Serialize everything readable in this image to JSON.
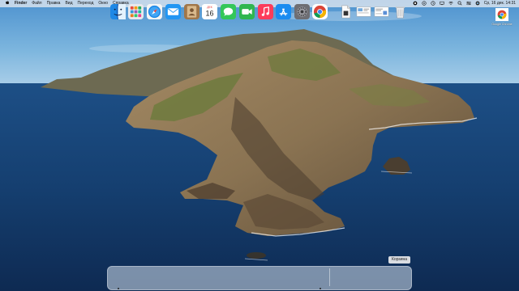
{
  "menubar": {
    "app_name": "Finder",
    "items": [
      "Файл",
      "Правка",
      "Вид",
      "Переход",
      "Окно",
      "Справка"
    ],
    "clock": "Ср, 16 дек.  14:31"
  },
  "desktop_icons": [
    {
      "label": "Google Chrome",
      "icon": "chrome-icon"
    }
  ],
  "dock": {
    "calendar": {
      "month": "ДЕК",
      "day": "16"
    },
    "tooltip": "Корзина",
    "apps": [
      "finder-icon",
      "launchpad-icon",
      "safari-icon",
      "mail-icon",
      "contacts-icon",
      "calendar-icon",
      "messages-icon",
      "facetime-icon",
      "music-icon",
      "app-store-icon",
      "system-preferences-icon",
      "chrome-icon"
    ],
    "files": [
      "document-icon",
      "screenshot-icon",
      "screenshot-icon",
      "trash-icon"
    ]
  },
  "colors": {
    "sea": "#153a66",
    "sky": "#6aa9d6",
    "menubar": "#e1e8f0"
  }
}
